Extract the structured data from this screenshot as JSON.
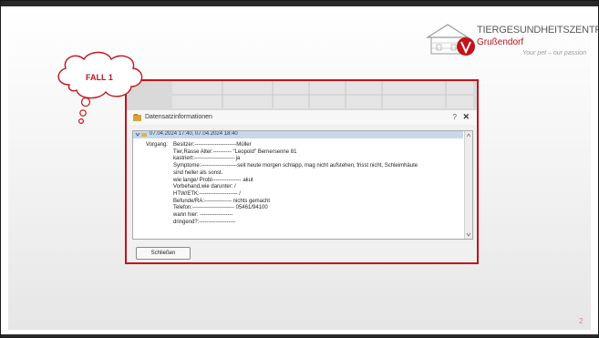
{
  "logo": {
    "title": "TIERGESUNDHEITSZENTRUM",
    "subtitle": "Grußendorf",
    "slogan": "Your pet – our passion"
  },
  "callout": {
    "label": "FALL 1"
  },
  "dialog": {
    "title": "Datensatzinformationen",
    "help": "?",
    "close": "✕",
    "selected_row": "07.04.2024 17:40, 07.04.2024 18:40",
    "vorgang_label": "Vorgang:",
    "lines": [
      "Besitzer:-----------------------Müller",
      "Tier,Rasse Alter:---------- \"Leopold\" Berner​senne 81",
      "kastriert:---------------------- ja",
      "Symptome:--------------------seit heute morgen schlapp, mag nicht aufstehen, frisst nicht, Schleimhäute",
      "sind heller als sonst.",
      "wie lange/ Probl---------------- akut",
      "Vorbehand,wie darunter: /",
      "HTW/ETK:--------------------- /",
      "Befunde/RA:--------------- nichts gemacht",
      "Telefon:----------------------- 05461/94100",
      "wann hier: ------------------",
      "dringend?:--------------------"
    ],
    "close_button": "Schließen"
  },
  "page_number": "2"
}
